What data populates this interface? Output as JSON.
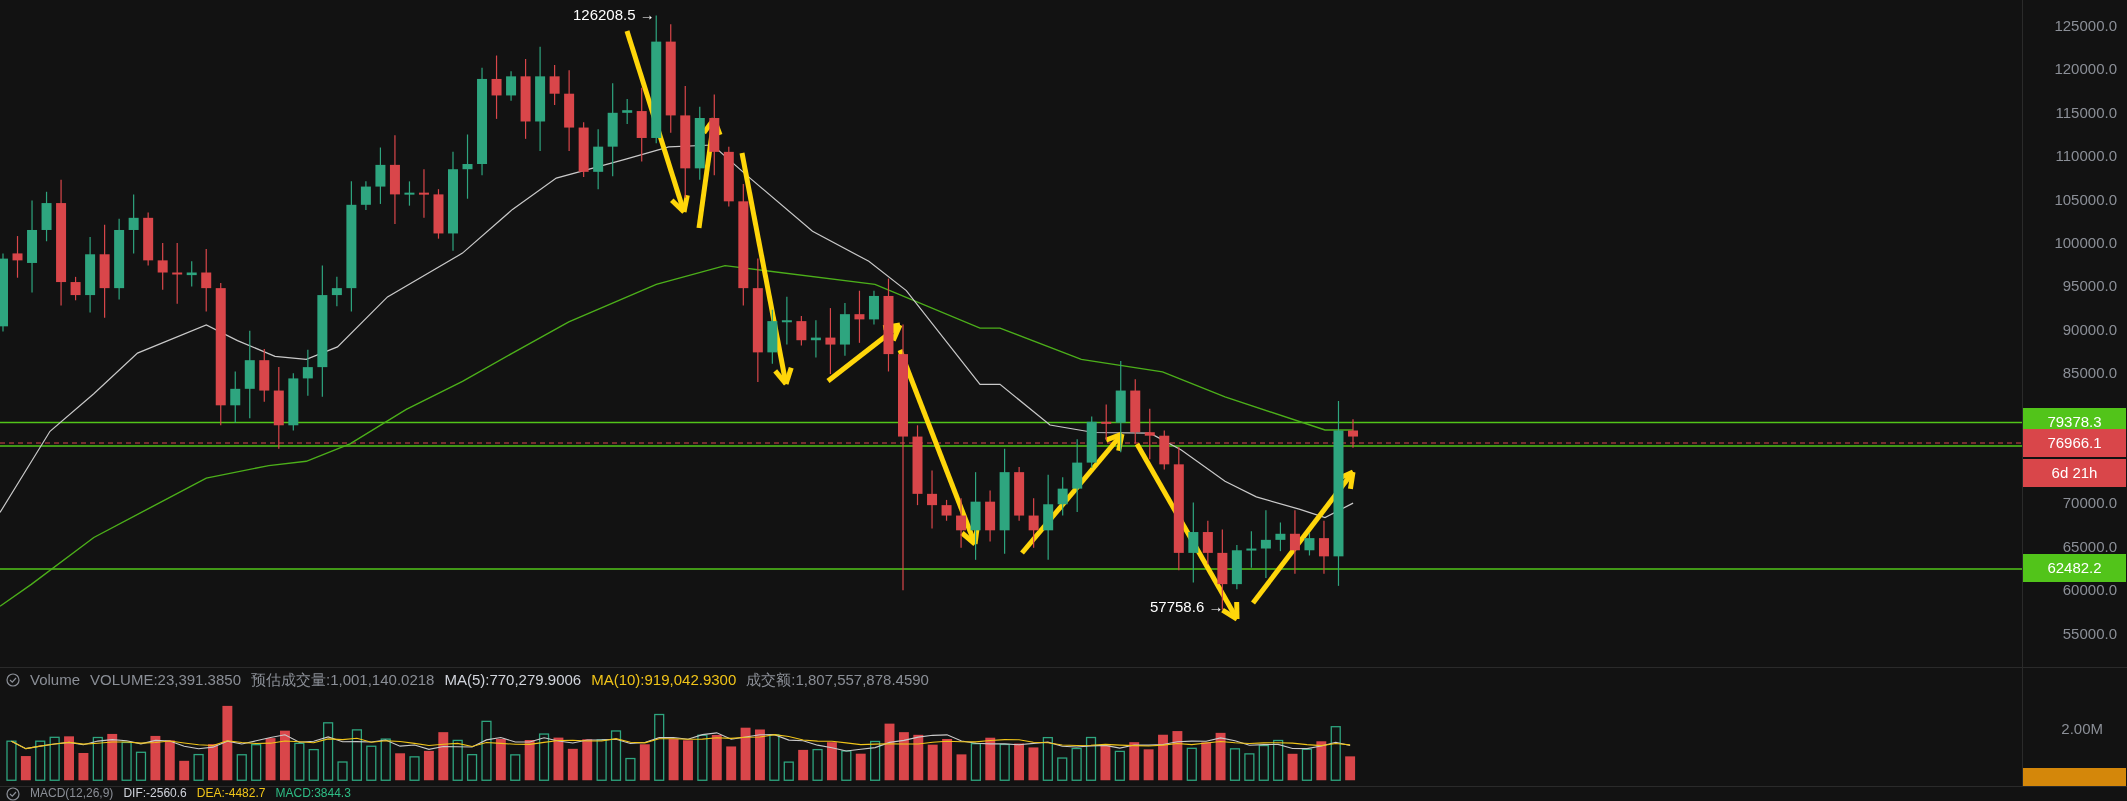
{
  "annotations": [
    {
      "kind": "high",
      "text": "126208.5 →"
    },
    {
      "kind": "low",
      "text": "57758.6 →"
    }
  ],
  "price_axis": {
    "ticks": [
      "125000.0",
      "120000.0",
      "115000.0",
      "110000.0",
      "105000.0",
      "100000.0",
      "95000.0",
      "90000.0",
      "85000.0",
      "70000.0",
      "65000.0",
      "60000.0",
      "55000.0"
    ]
  },
  "price_tags": [
    {
      "kind": "level",
      "text": "79378.3"
    },
    {
      "kind": "last",
      "text": "76966.1"
    },
    {
      "kind": "countdown",
      "text": "6d 21h"
    },
    {
      "kind": "level",
      "text": "62482.2"
    }
  ],
  "volume": {
    "legend": [
      {
        "text": "Volume",
        "color": "#8b8f97"
      },
      {
        "text": "VOLUME:23,391.3850",
        "color": "#8b8f97"
      },
      {
        "text": "预估成交量:1,001,140.0218",
        "color": "#8b8f97"
      },
      {
        "text": "MA(5):770,279.9006",
        "color": "#d1d4dc"
      },
      {
        "text": "MA(10):919,042.9300",
        "color": "#f0c419"
      },
      {
        "text": "成交额:1,807,557,878.4590",
        "color": "#8b8f97"
      }
    ],
    "axis_ticks": [
      "2.00M"
    ]
  },
  "macd": {
    "legend": [
      {
        "text": "MACD(12,26,9)",
        "color": "#8b8f97"
      },
      {
        "text": "DIF:-2560.6",
        "color": "#d1d4dc"
      },
      {
        "text": "DEA:-4482.7",
        "color": "#f0c419"
      },
      {
        "text": "MACD:3844.3",
        "color": "#2ebd85"
      }
    ]
  }
}
